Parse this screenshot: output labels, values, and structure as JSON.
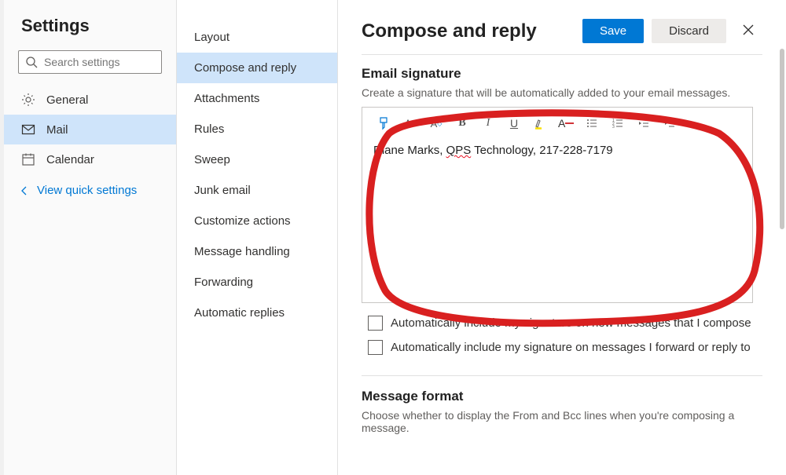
{
  "left": {
    "title": "Settings",
    "search_placeholder": "Search settings",
    "nav": {
      "general": "General",
      "mail": "Mail",
      "calendar": "Calendar"
    },
    "quick": "View quick settings"
  },
  "mid": {
    "items": [
      "Layout",
      "Compose and reply",
      "Attachments",
      "Rules",
      "Sweep",
      "Junk email",
      "Customize actions",
      "Message handling",
      "Forwarding",
      "Automatic replies"
    ],
    "active_index": 1
  },
  "main": {
    "title": "Compose and reply",
    "save": "Save",
    "discard": "Discard",
    "sig_title": "Email signature",
    "sig_desc": "Create a signature that will be automatically added to your email messages.",
    "signature_pre": "Diane Marks, ",
    "signature_spell": "QPS",
    "signature_post": " Technology, 217-228-7179",
    "cb1": "Automatically include my signature on new messages that I compose",
    "cb2": "Automatically include my signature on messages I forward or reply to",
    "msgfmt_title": "Message format",
    "msgfmt_desc": "Choose whether to display the From and Bcc lines when you're composing a message."
  }
}
